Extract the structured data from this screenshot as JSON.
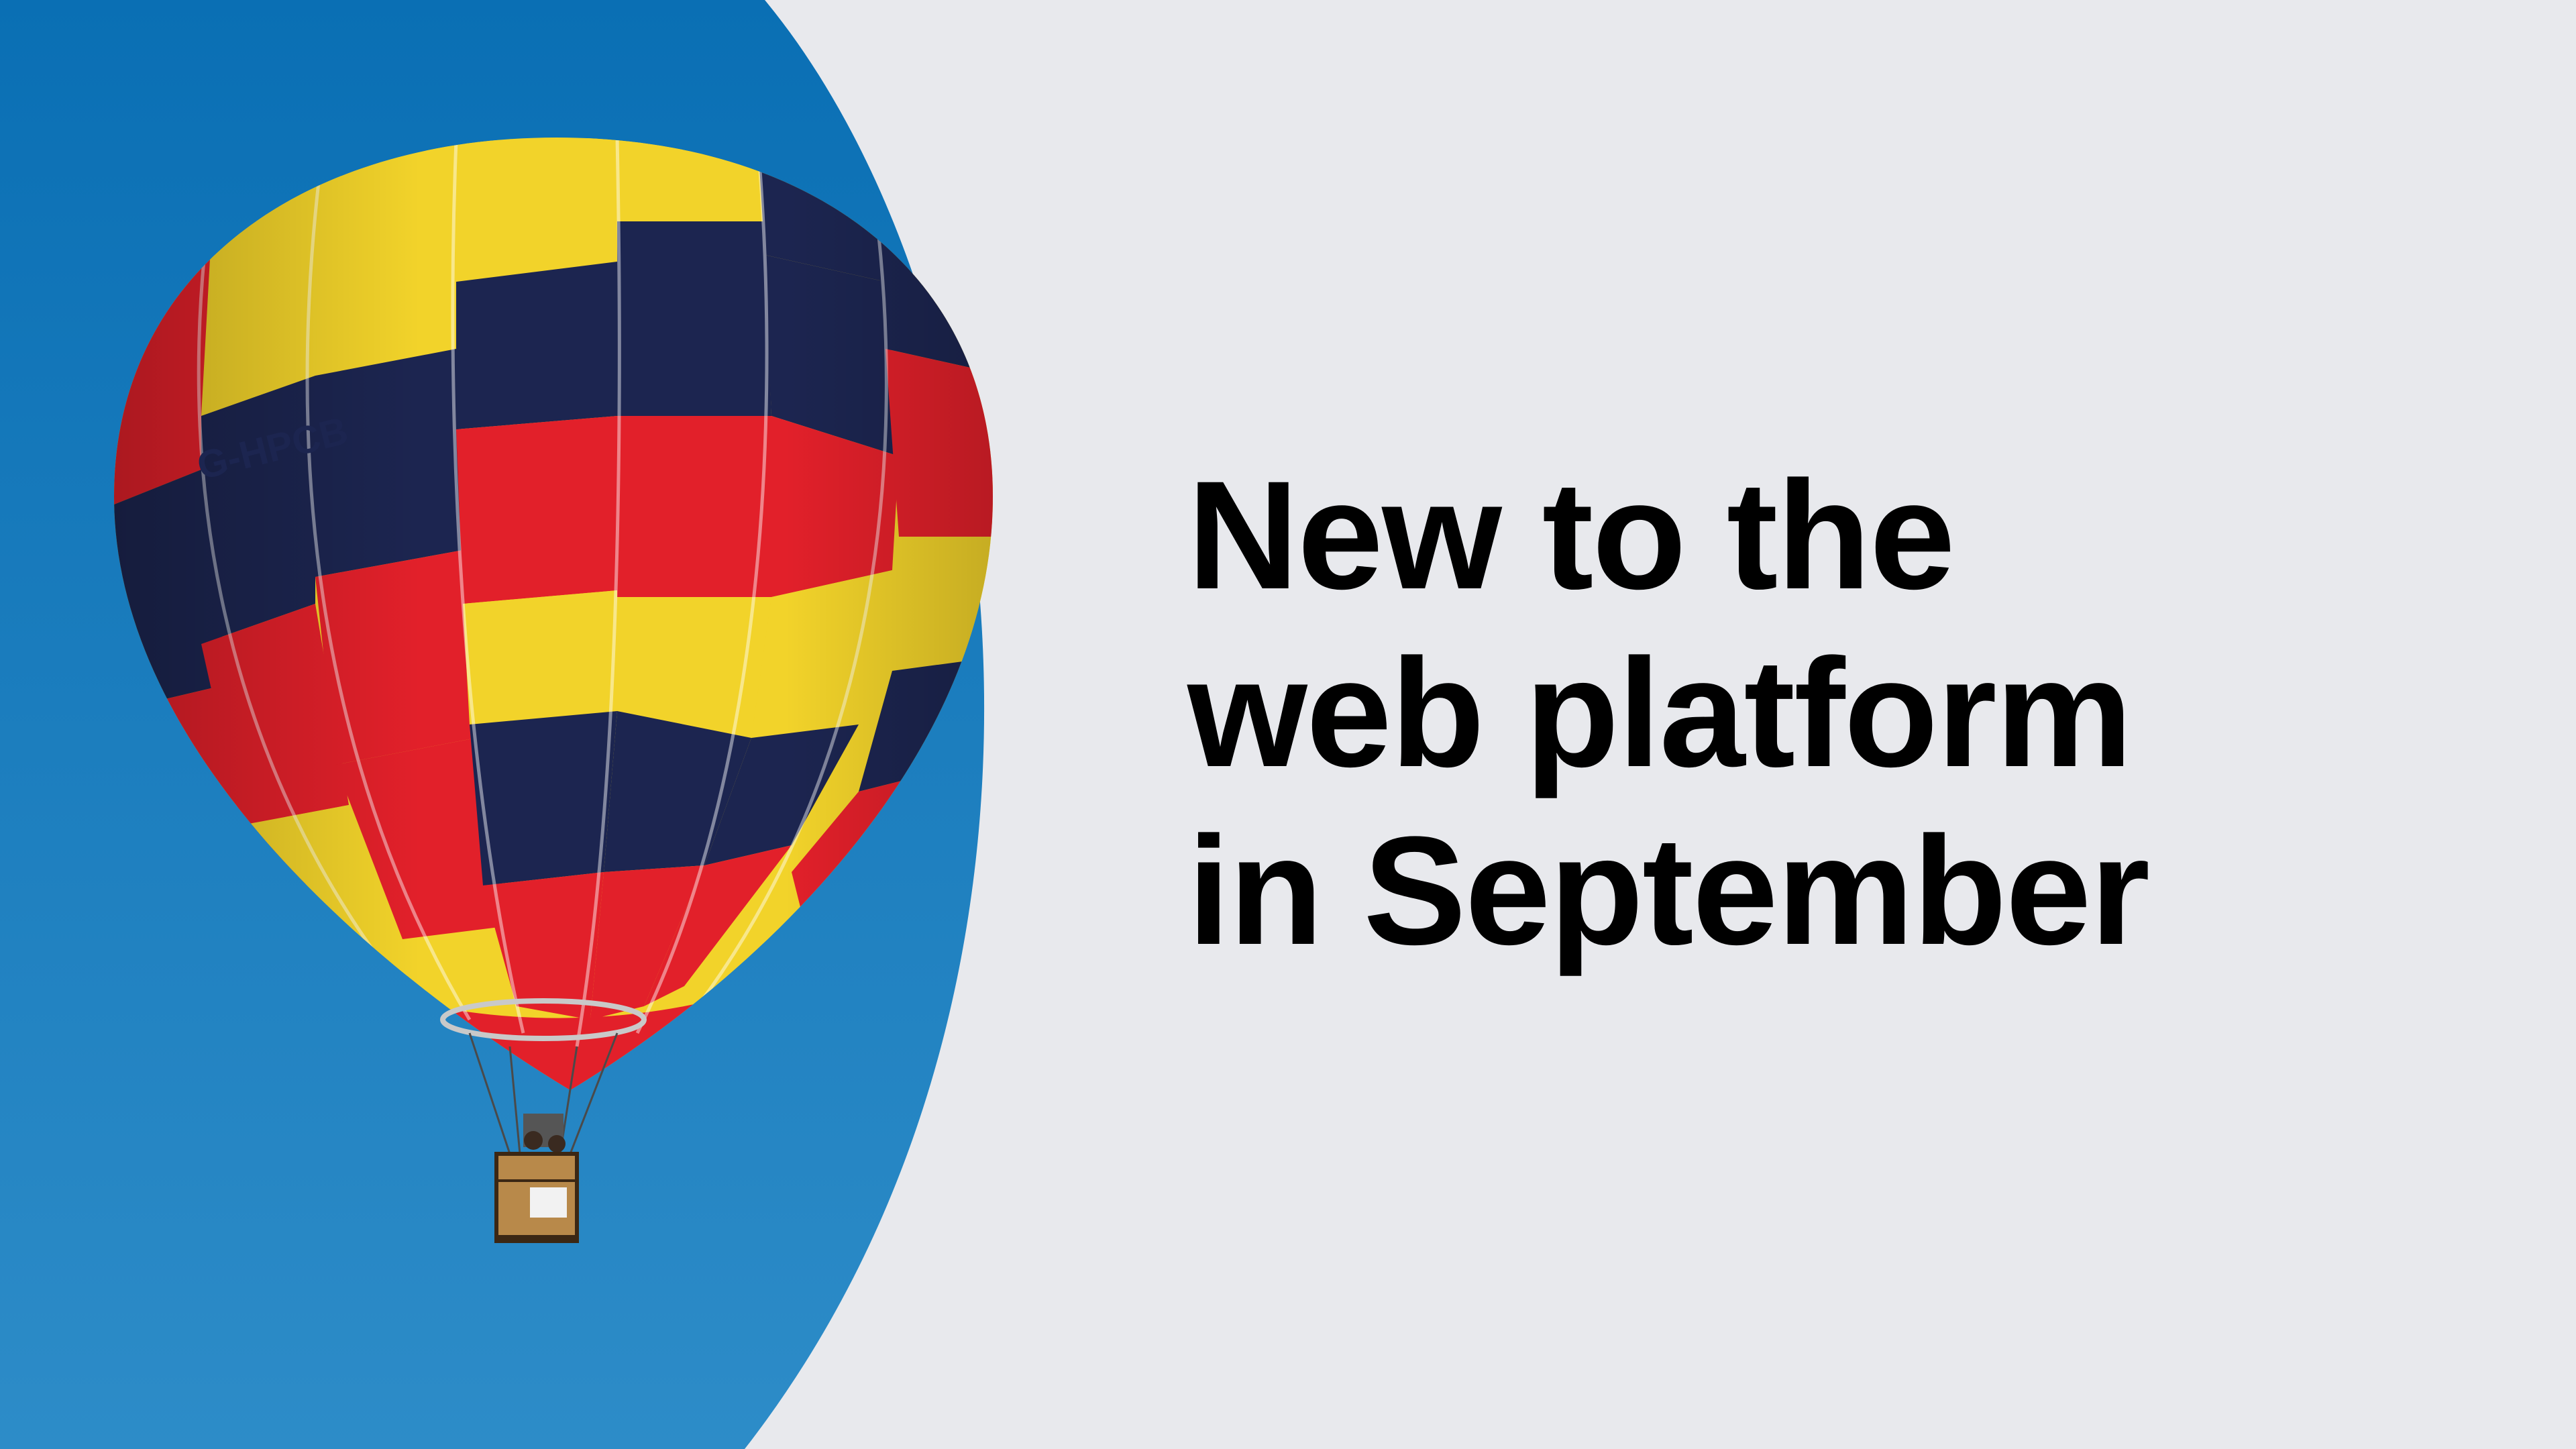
{
  "headline": {
    "line1": "New to the",
    "line2": "web platform",
    "line3": "in September"
  },
  "balloon": {
    "registration": "G-HPCB"
  },
  "colors": {
    "background": "#e8e9ed",
    "sky_top": "#0a6fb4",
    "sky_bottom": "#2d8cc8",
    "balloon_yellow": "#f2d32a",
    "balloon_red": "#e2202a",
    "balloon_navy": "#1c2550",
    "text": "#000000"
  }
}
